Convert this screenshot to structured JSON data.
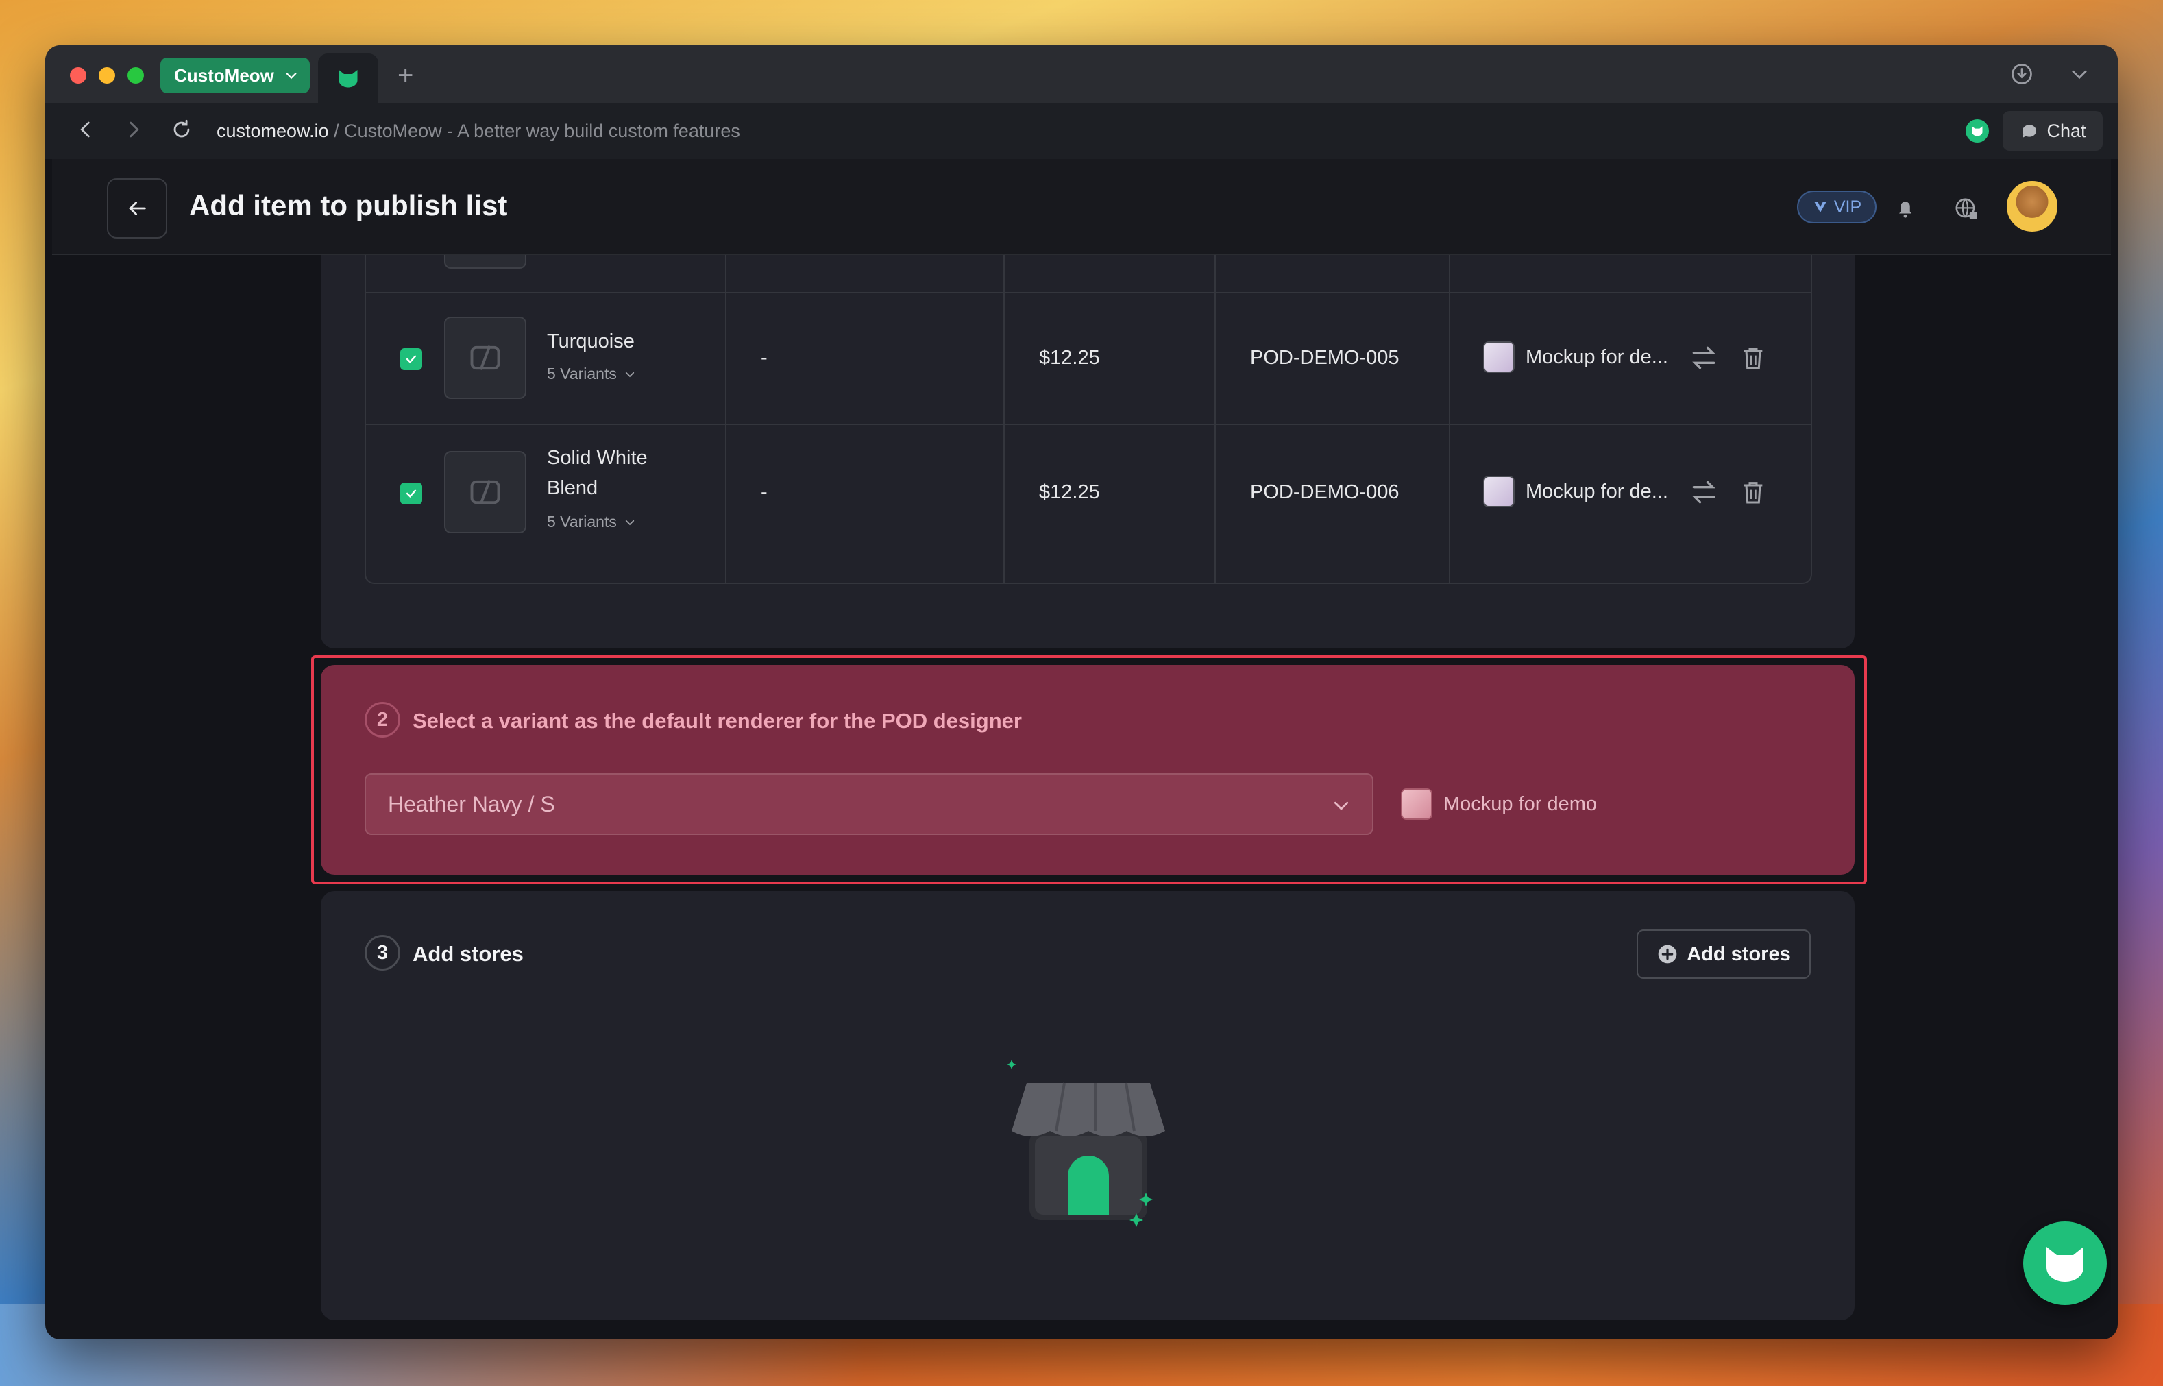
{
  "browser": {
    "space_name": "CustoMeow",
    "url_domain": "customeow.io",
    "url_rest": " / CustoMeow - A better way build custom features",
    "chat_label": "Chat"
  },
  "header": {
    "title": "Add item to publish list",
    "vip_label": "VIP"
  },
  "table": {
    "rows": [
      {
        "name_lines": [
          "Turquoise"
        ],
        "variants": "5 Variants",
        "col2": "-",
        "price": "$12.25",
        "sku": "POD-DEMO-005",
        "mockup": "Mockup for de...",
        "checked": true
      },
      {
        "name_lines": [
          "Solid White",
          "Blend"
        ],
        "variants": "5 Variants",
        "col2": "-",
        "price": "$12.25",
        "sku": "POD-DEMO-006",
        "mockup": "Mockup for de...",
        "checked": true
      }
    ]
  },
  "step2": {
    "number": "2",
    "title": "Select a variant as the default renderer for the POD designer",
    "selected_variant": "Heather Navy / S",
    "mockup": "Mockup for demo"
  },
  "step3": {
    "number": "3",
    "title": "Add stores",
    "button_label": "Add stores"
  },
  "colors": {
    "accent": "#1fbf7a",
    "highlight_border": "#e83a4e",
    "highlight_bg": "#7a2b42"
  }
}
